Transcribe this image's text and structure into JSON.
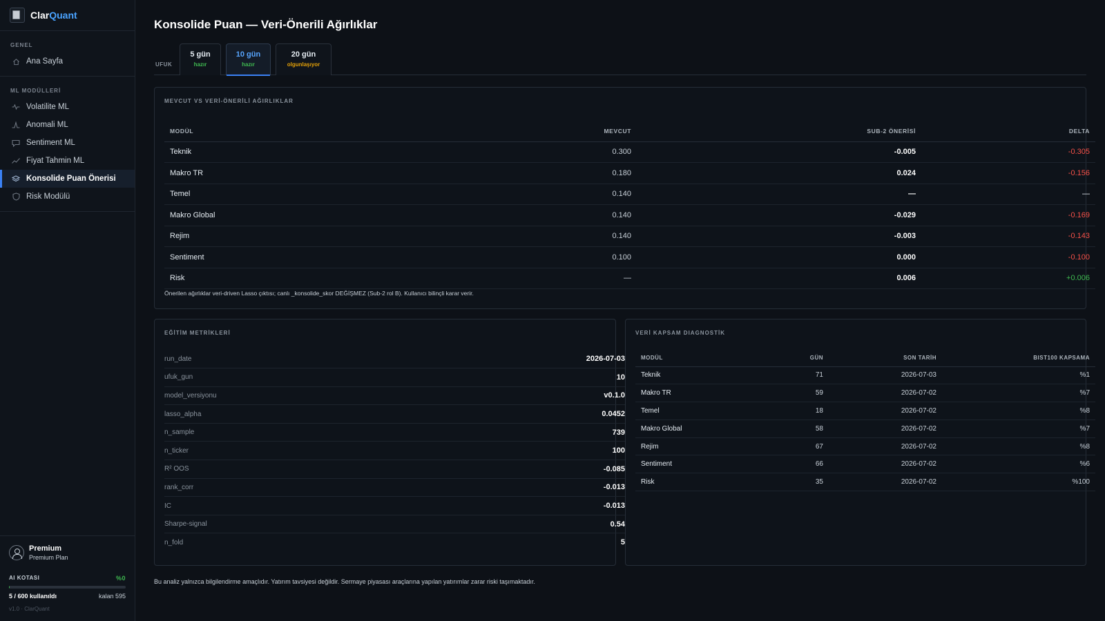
{
  "brand": {
    "name_prefix": "Clar",
    "name_suffix": "Quant"
  },
  "sidebar": {
    "section_general": "GENEL",
    "home": "Ana Sayfa",
    "section_ml": "ML MODÜLLERİ",
    "items": [
      {
        "label": "Volatilite ML",
        "icon": "pulse-icon"
      },
      {
        "label": "Anomali ML",
        "icon": "spike-icon"
      },
      {
        "label": "Sentiment ML",
        "icon": "chat-icon"
      },
      {
        "label": "Fiyat Tahmin ML",
        "icon": "trend-icon"
      },
      {
        "label": "Konsolide Puan Önerisi",
        "icon": "layers-icon",
        "active": true
      },
      {
        "label": "Risk Modülü",
        "icon": "shield-icon"
      }
    ]
  },
  "user": {
    "name": "Premium",
    "plan": "Premium Plan"
  },
  "quota": {
    "label": "AI KOTASI",
    "percent_text": "%0",
    "fill_fraction": 0.0083,
    "used": "5 / 600 kullanıldı",
    "remaining": "kalan 595"
  },
  "version": "v1.0 · ClarQuant",
  "page": {
    "title": "Konsolide Puan — Veri-Önerili Ağırlıklar"
  },
  "horizon": {
    "label": "UFUK",
    "tabs": [
      {
        "label": "5 gün",
        "status": "hazır",
        "status_type": "ready"
      },
      {
        "label": "10 gün",
        "status": "hazır",
        "status_type": "ready",
        "active": true
      },
      {
        "label": "20 gün",
        "status": "olgunlaşıyor",
        "status_type": "pending"
      }
    ]
  },
  "weights": {
    "title": "MEVCUT VS VERİ-ÖNERİLİ AĞIRLIKLAR",
    "headers": [
      "MODÜL",
      "MEVCUT",
      "SUB-2 ÖNERİSİ",
      "DELTA"
    ],
    "rows": [
      {
        "module": "Teknik",
        "current": "0.300",
        "suggested": "-0.005",
        "delta": "-0.305",
        "sign": "neg"
      },
      {
        "module": "Makro TR",
        "current": "0.180",
        "suggested": "0.024",
        "delta": "-0.156",
        "sign": "neg"
      },
      {
        "module": "Temel",
        "current": "0.140",
        "suggested": "—",
        "delta": "—",
        "sign": "neu"
      },
      {
        "module": "Makro Global",
        "current": "0.140",
        "suggested": "-0.029",
        "delta": "-0.169",
        "sign": "neg"
      },
      {
        "module": "Rejim",
        "current": "0.140",
        "suggested": "-0.003",
        "delta": "-0.143",
        "sign": "neg"
      },
      {
        "module": "Sentiment",
        "current": "0.100",
        "suggested": "0.000",
        "delta": "-0.100",
        "sign": "neg"
      },
      {
        "module": "Risk",
        "current": "—",
        "suggested": "0.006",
        "delta": "+0.006",
        "sign": "pos"
      }
    ],
    "note": "Önerilen ağırlıklar veri-driven Lasso çıktısı; canlı _konsolide_skor DEĞİŞMEZ (Sub-2 rol B). Kullanıcı bilinçli karar verir."
  },
  "training": {
    "title": "EĞİTİM METRİKLERİ",
    "rows": [
      {
        "key": "run_date",
        "value": "2026-07-03"
      },
      {
        "key": "ufuk_gun",
        "value": "10"
      },
      {
        "key": "model_versiyonu",
        "value": "v0.1.0"
      },
      {
        "key": "lasso_alpha",
        "value": "0.0452"
      },
      {
        "key": "n_sample",
        "value": "739"
      },
      {
        "key": "n_ticker",
        "value": "100"
      },
      {
        "key": "R² OOS",
        "value": "-0.085"
      },
      {
        "key": "rank_corr",
        "value": "-0.013"
      },
      {
        "key": "IC",
        "value": "-0.013"
      },
      {
        "key": "Sharpe-signal",
        "value": "0.54"
      },
      {
        "key": "n_fold",
        "value": "5"
      }
    ]
  },
  "coverage": {
    "title": "VERİ KAPSAM DIAGNOSTİK",
    "headers": [
      "MODÜL",
      "GÜN",
      "SON TARİH",
      "BIST100 KAPSAMA"
    ],
    "rows": [
      {
        "module": "Teknik",
        "days": "71",
        "last": "2026-07-03",
        "cov": "%1"
      },
      {
        "module": "Makro TR",
        "days": "59",
        "last": "2026-07-02",
        "cov": "%7"
      },
      {
        "module": "Temel",
        "days": "18",
        "last": "2026-07-02",
        "cov": "%8"
      },
      {
        "module": "Makro Global",
        "days": "58",
        "last": "2026-07-02",
        "cov": "%7"
      },
      {
        "module": "Rejim",
        "days": "67",
        "last": "2026-07-02",
        "cov": "%8"
      },
      {
        "module": "Sentiment",
        "days": "66",
        "last": "2026-07-02",
        "cov": "%6"
      },
      {
        "module": "Risk",
        "days": "35",
        "last": "2026-07-02",
        "cov": "%100"
      }
    ]
  },
  "disclaimer": "Bu analiz yalnızca bilgilendirme amaçlıdır. Yatırım tavsiyesi değildir. Sermaye piyasası araçlarına yapılan yatırımlar zarar riski taşımaktadır."
}
